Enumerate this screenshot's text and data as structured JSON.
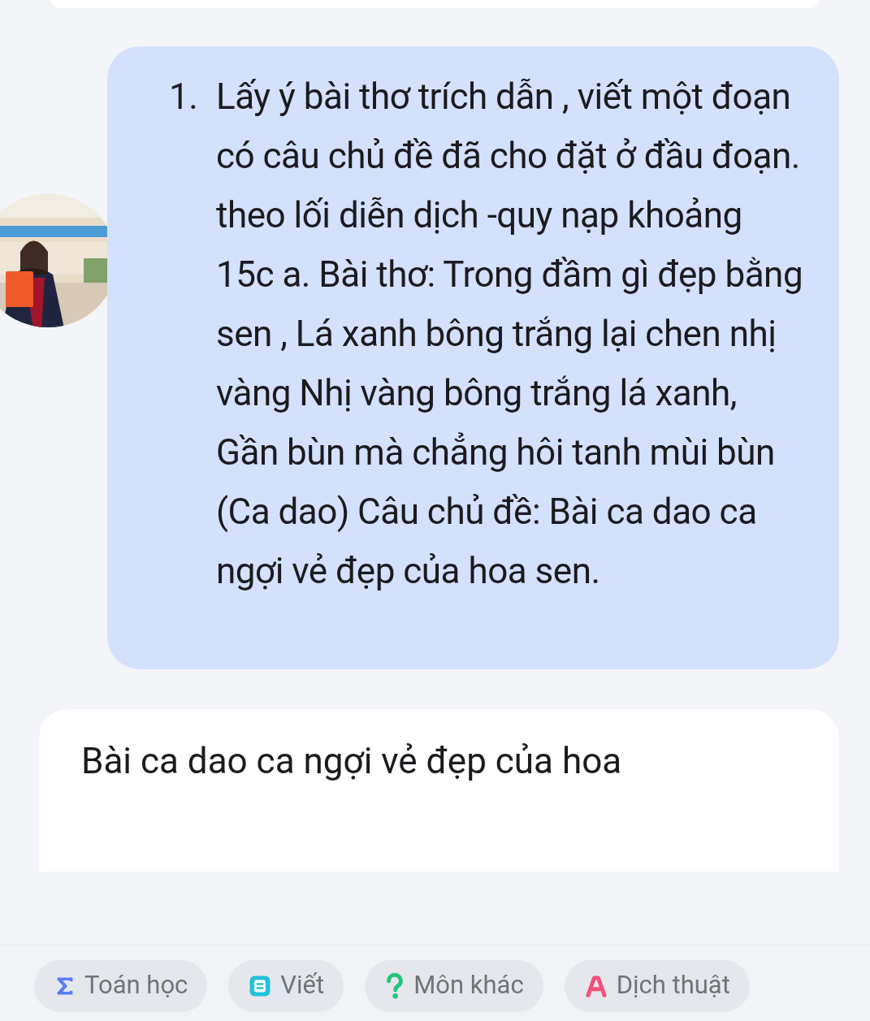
{
  "question": {
    "number": "1.",
    "text": "Lấy ý bài thơ trích dẫn , viết một đoạn có câu chủ đề đã cho đặt ở đầu đoạn. theo lối diễn dịch -quy nạp khoảng 15c a. Bài thơ: Trong đầm gì đẹp bằng sen , Lá xanh bông trắng lại chen nhị vàng Nhị vàng bông trắng lá xanh, Gần bùn mà chẳng hôi tanh mùi bùn (Ca dao) Câu chủ đề: Bài ca dao ca ngợi vẻ đẹp của hoa sen."
  },
  "answer": {
    "text": "Bài ca dao ca ngợi vẻ đẹp của hoa"
  },
  "subjects": [
    {
      "kind": "math",
      "label": "Toán học"
    },
    {
      "kind": "writing",
      "label": "Viết"
    },
    {
      "kind": "other",
      "label": "Môn khác"
    },
    {
      "kind": "translate",
      "label": "Dịch thuật"
    }
  ]
}
